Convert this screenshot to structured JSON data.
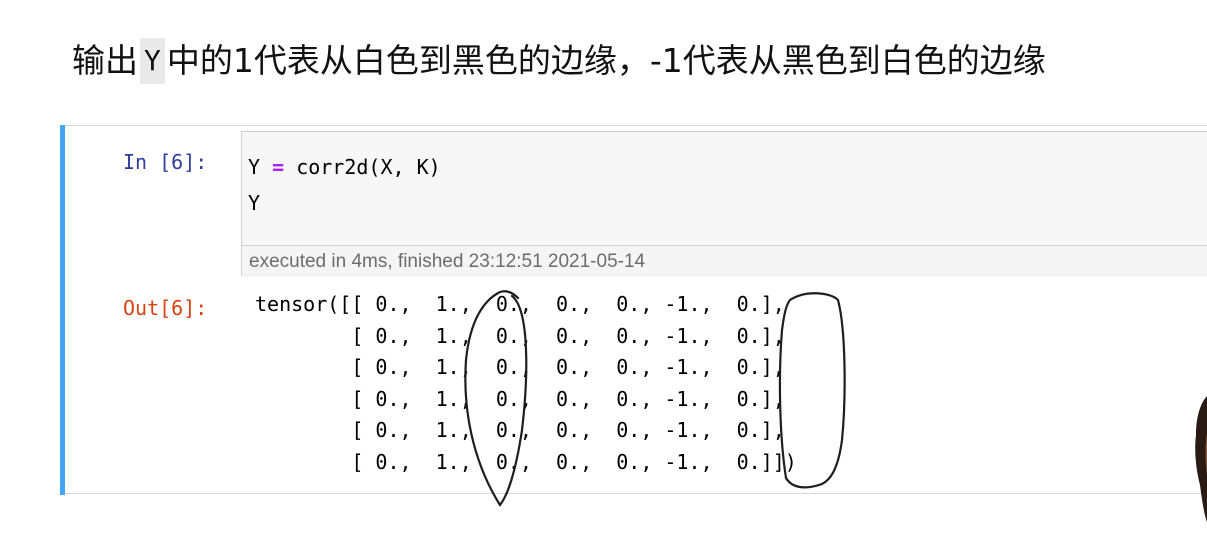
{
  "headline": {
    "prefix": "输出",
    "code": "Y",
    "suffix": "中的1代表从白色到黑色的边缘，-1代表从黑色到白色的边缘"
  },
  "cell": {
    "in_prompt": "In [6]:",
    "code_line1_var": "Y",
    "code_line1_op": "=",
    "code_line1_rest": "corr2d(X, K)",
    "code_line2": "Y",
    "exec_info": "executed in 4ms, finished 23:12:51 2021-05-14",
    "out_prompt": "Out[6]:",
    "output_lines": [
      "tensor([[ 0.,  1.,  0.,  0.,  0., -1.,  0.],",
      "        [ 0.,  1.,  0.,  0.,  0., -1.,  0.],",
      "        [ 0.,  1.,  0.,  0.,  0., -1.,  0.],",
      "        [ 0.,  1.,  0.,  0.,  0., -1.,  0.],",
      "        [ 0.,  1.,  0.,  0.,  0., -1.,  0.],",
      "        [ 0.,  1.,  0.,  0.,  0., -1.,  0.]])"
    ]
  },
  "colors": {
    "cell_bar": "#42a5f5",
    "in_prompt": "#303f9f",
    "out_prompt": "#d84315",
    "operator": "#aa22ff"
  }
}
